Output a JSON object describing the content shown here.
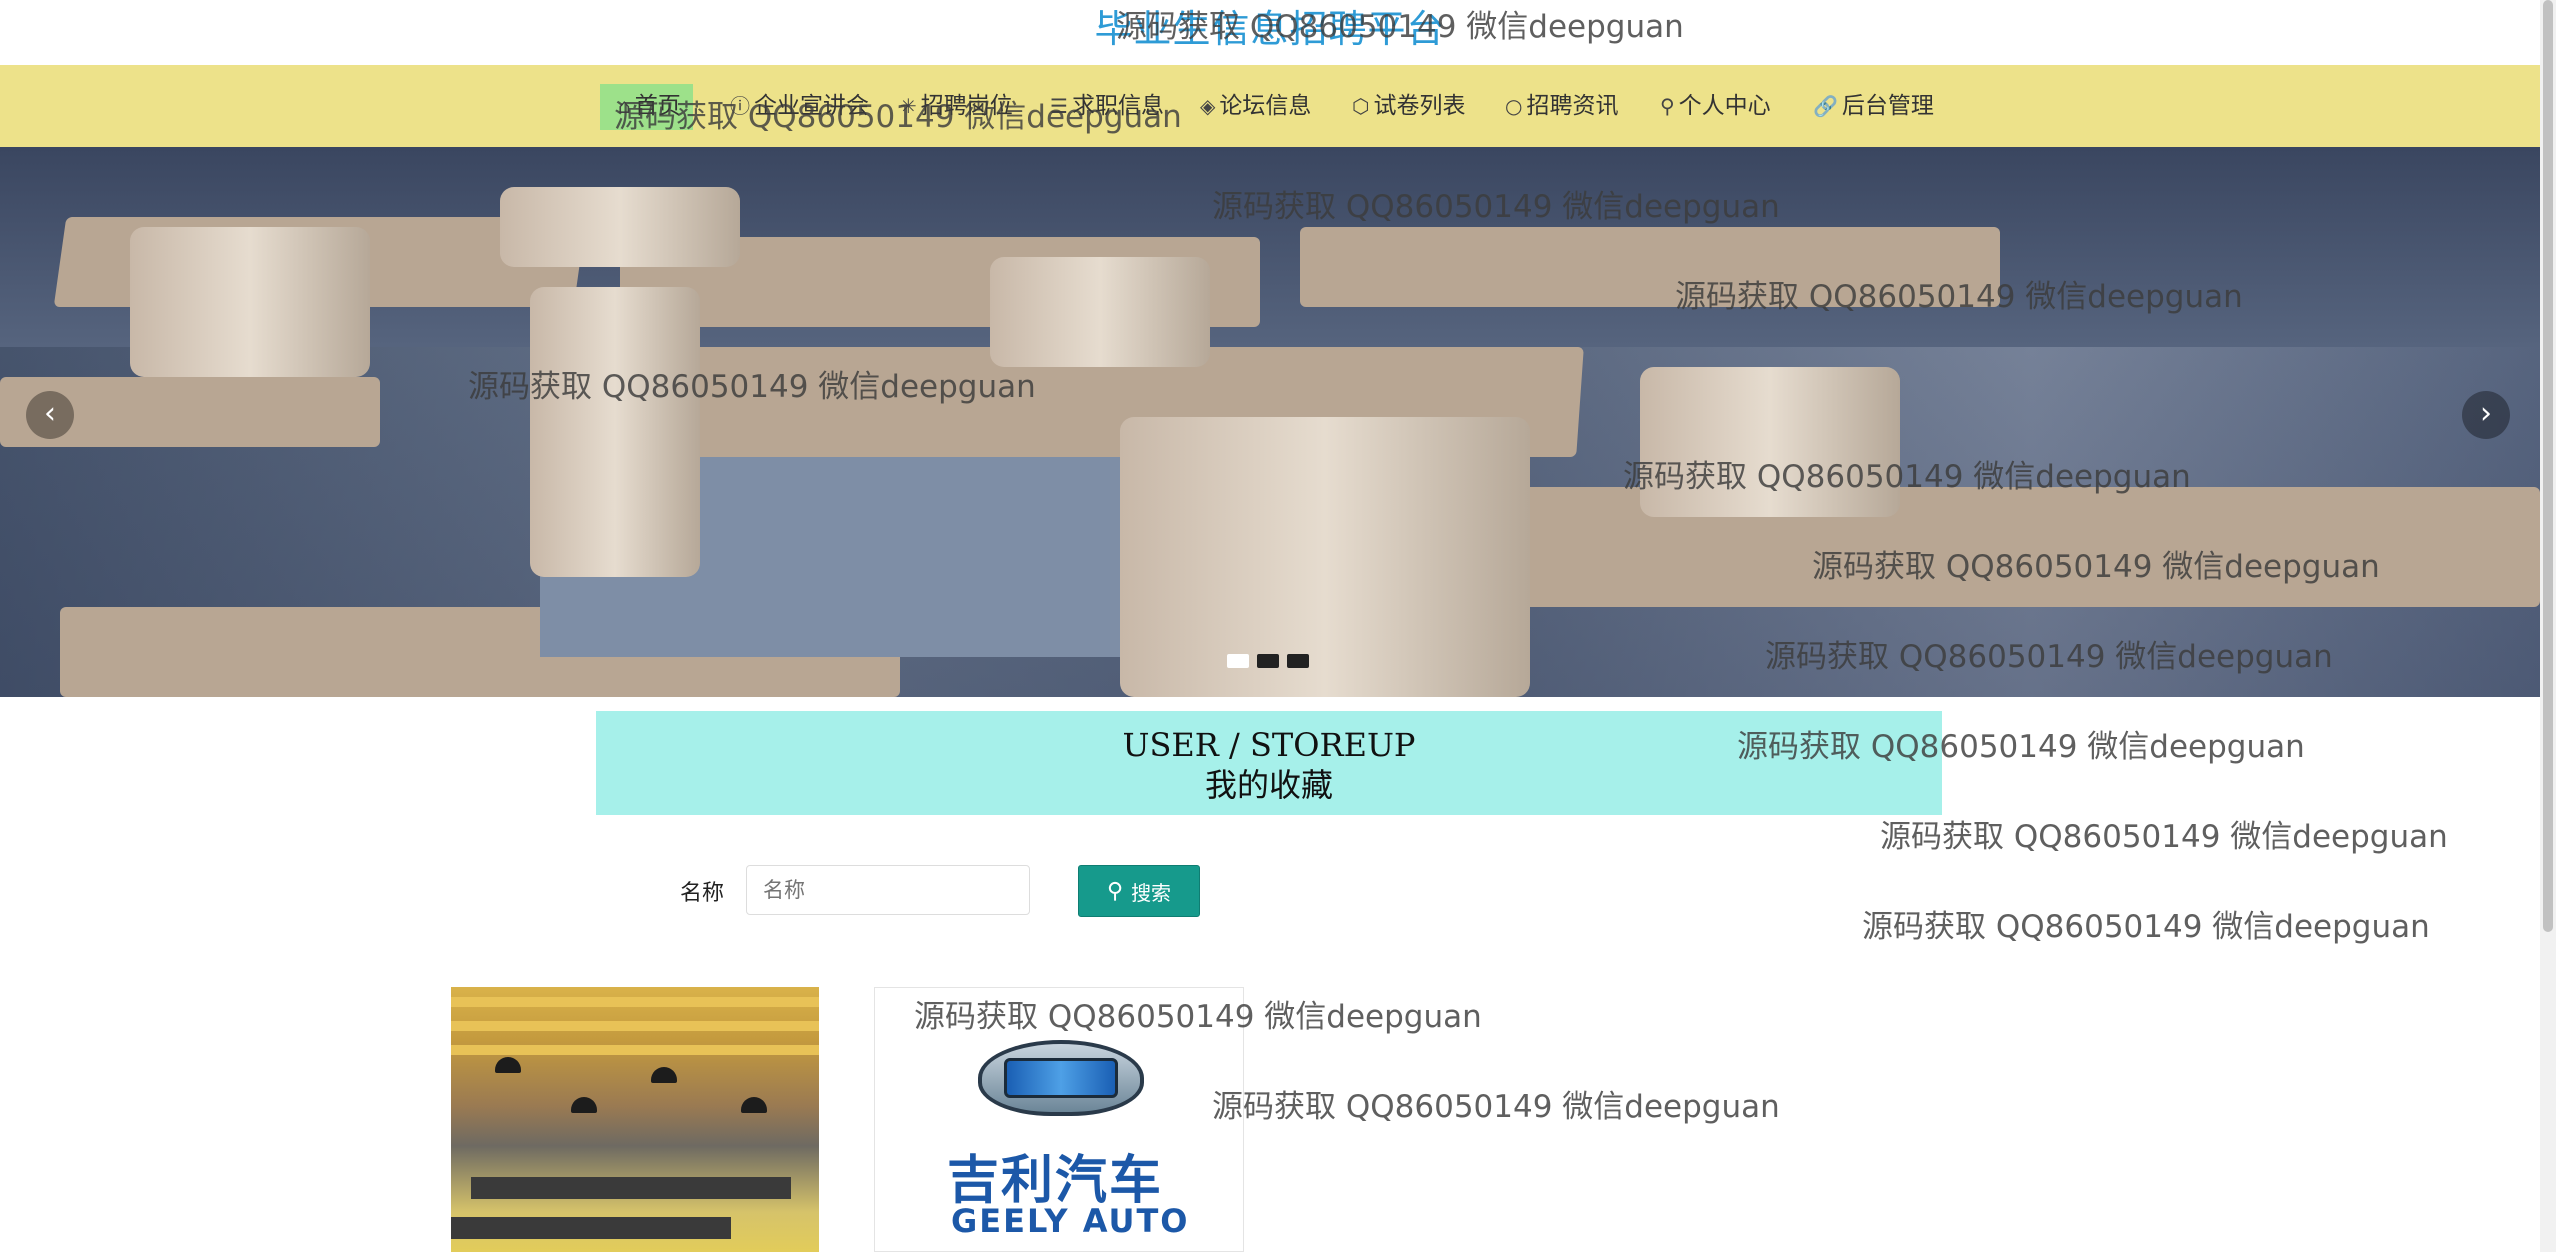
{
  "site": {
    "title": "毕业生信息招聘平台"
  },
  "nav": {
    "items": [
      {
        "label": "首页",
        "icon": "home-icon"
      },
      {
        "label": "企业宣讲会",
        "icon": "info-icon"
      },
      {
        "label": "招聘岗位",
        "icon": "star-icon"
      },
      {
        "label": "求职信息",
        "icon": "list-icon"
      },
      {
        "label": "论坛信息",
        "icon": "layers-icon"
      },
      {
        "label": "试卷列表",
        "icon": "cube-icon"
      },
      {
        "label": "招聘资讯",
        "icon": "circle-icon"
      },
      {
        "label": "个人中心",
        "icon": "user-icon"
      },
      {
        "label": "后台管理",
        "icon": "link-icon"
      }
    ]
  },
  "carousel": {
    "prev": "‹",
    "next": "›",
    "slide_count": 3,
    "active_index": 0
  },
  "section": {
    "title_en": "USER / STOREUP",
    "title_cn": "我的收藏"
  },
  "search": {
    "label": "名称",
    "placeholder": "名称",
    "value": "",
    "button_label": "搜索"
  },
  "cards": [
    {
      "image": "office-interior"
    },
    {
      "image": "geely-logo",
      "logo_cn": "吉利汽车",
      "logo_en": "GEELY AUTO"
    }
  ],
  "watermark": "源码获取 QQ86050149 微信deepguan"
}
